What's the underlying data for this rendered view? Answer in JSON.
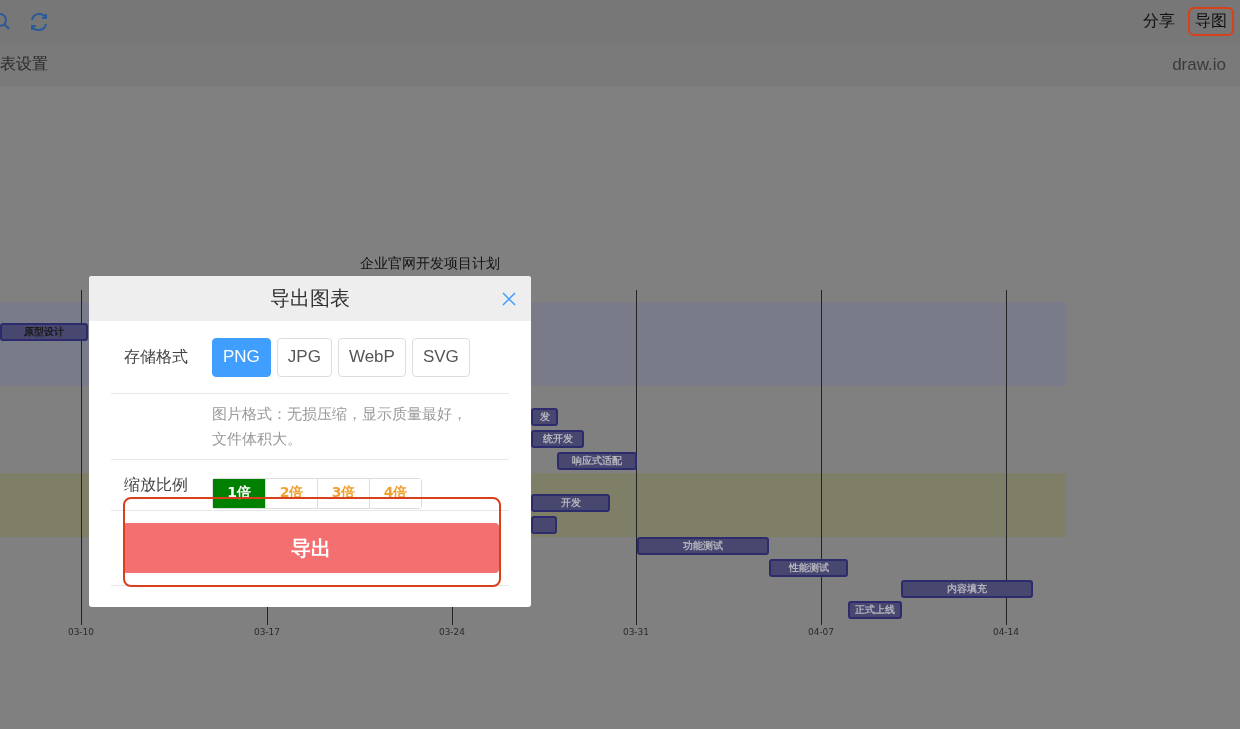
{
  "toolbar": {
    "actions": [
      {
        "label": "分享",
        "highlighted": false
      },
      {
        "label": "导图",
        "highlighted": true
      }
    ]
  },
  "settings_bar": {
    "title": "表设置",
    "brand": "draw.io"
  },
  "gantt": {
    "title": "企业官网开发项目计划",
    "tasks": [
      {
        "label": "原型设计"
      },
      {
        "label": "发"
      },
      {
        "label": "统开发"
      },
      {
        "label": "响应式适配"
      },
      {
        "label": "开发"
      },
      {
        "label": "功能测试"
      },
      {
        "label": "性能测试"
      },
      {
        "label": "内容填充"
      },
      {
        "label": "正式上线"
      }
    ],
    "ticks": [
      "03-10",
      "03-17",
      "03-24",
      "03-31",
      "04-07",
      "04-14"
    ]
  },
  "dialog": {
    "title": "导出图表",
    "format": {
      "label": "存储格式",
      "options": [
        {
          "label": "PNG",
          "selected": true
        },
        {
          "label": "JPG",
          "selected": false
        },
        {
          "label": "WebP",
          "selected": false
        },
        {
          "label": "SVG",
          "selected": false
        }
      ],
      "description": "图片格式：无损压缩，显示质量最好，文件体积大。"
    },
    "scale": {
      "label": "缩放比例",
      "options": [
        {
          "label": "1倍",
          "selected": true
        },
        {
          "label": "2倍",
          "selected": false
        },
        {
          "label": "3倍",
          "selected": false
        },
        {
          "label": "4倍",
          "selected": false
        }
      ]
    },
    "export_button": {
      "label": "导出",
      "highlighted": true
    }
  }
}
